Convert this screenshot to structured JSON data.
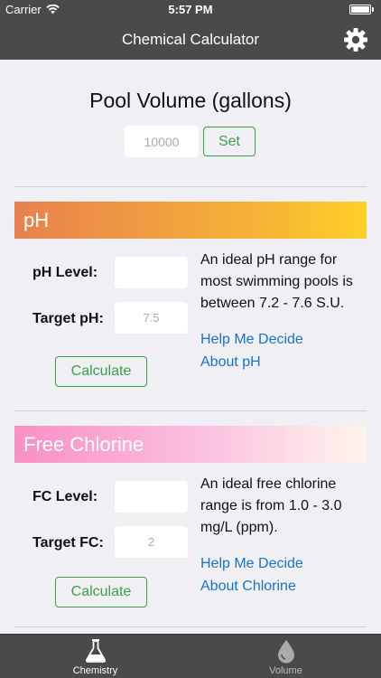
{
  "status_bar": {
    "carrier": "Carrier",
    "time": "5:57 PM",
    "battery_level": 1.0
  },
  "nav": {
    "title": "Chemical Calculator",
    "settings_icon": "gear-icon"
  },
  "pool": {
    "title": "Pool Volume (gallons)",
    "volume_placeholder": "10000",
    "set_label": "Set"
  },
  "ph": {
    "header": "pH",
    "level_label": "pH Level:",
    "level_value": "",
    "target_label": "Target pH:",
    "target_placeholder": "7.5",
    "calculate_label": "Calculate",
    "info": "An ideal pH range for most swimming pools is between 7.2 - 7.6 S.U.",
    "help_link": "Help Me Decide",
    "about_link": "About pH"
  },
  "fc": {
    "header": "Free Chlorine",
    "level_label": "FC Level:",
    "level_value": "",
    "target_label": "Target FC:",
    "target_placeholder": "2",
    "calculate_label": "Calculate",
    "info": "An ideal free chlorine range is from 1.0 - 3.0 mg/L (ppm).",
    "help_link": "Help Me Decide",
    "about_link": "About Chlorine"
  },
  "tabs": [
    {
      "label": "Chemistry",
      "icon": "flask-icon",
      "selected": true
    },
    {
      "label": "Volume",
      "icon": "water-drop-icon",
      "selected": false
    }
  ],
  "colors": {
    "bar_bg": "#4a4a4a",
    "accent_green": "#3aa34a",
    "link_blue": "#1a73c8",
    "ph_gradient_start": "#e8814e",
    "ph_gradient_end": "#fdd028",
    "fc_gradient_start": "#f98fc4",
    "fc_gradient_end": "#fdf5eb"
  }
}
